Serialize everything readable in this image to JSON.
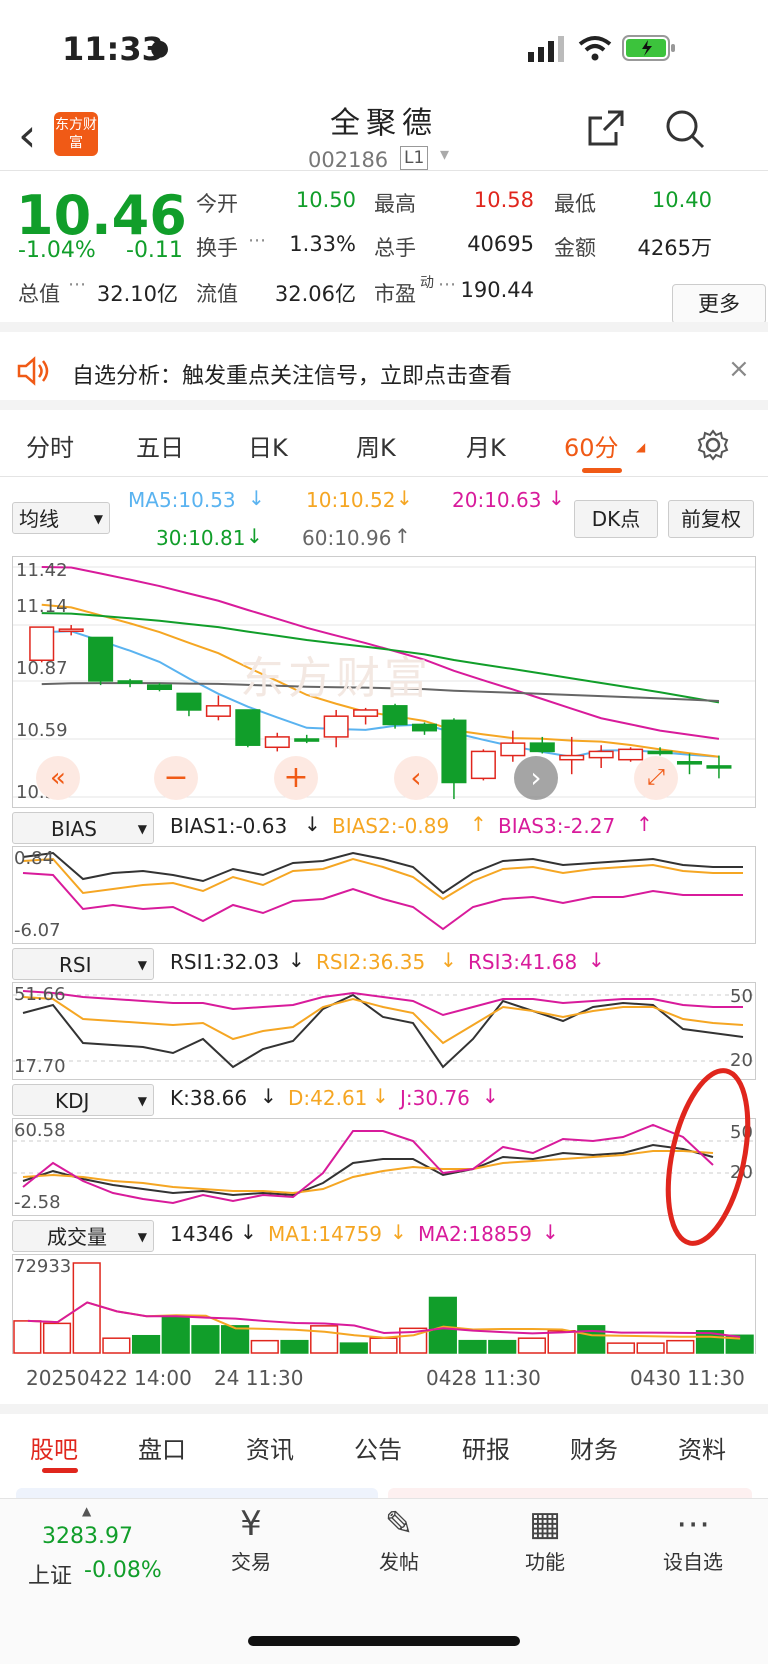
{
  "status": {
    "time": "11:33"
  },
  "nav": {
    "title": "全聚德",
    "code": "002186",
    "level_badge": "L1",
    "logo_text": "东方财富"
  },
  "quote": {
    "price": "10.46",
    "change_pct": "-1.04%",
    "change_abs": "-0.11",
    "open_label": "今开",
    "open": "10.50",
    "high_label": "最高",
    "high": "10.58",
    "low_label": "最低",
    "low": "10.40",
    "turnover_label": "换手",
    "turnover": "1.33%",
    "volume_label": "总手",
    "volume": "40695",
    "amount_label": "金额",
    "amount": "4265万",
    "mcap_label": "总值",
    "mcap": "32.10亿",
    "float_label": "流值",
    "float_cap": "32.06亿",
    "pe_label": "市盈",
    "pe_sup": "动",
    "pe": "190.44",
    "more_label": "更多"
  },
  "banner": {
    "text": "自选分析：触发重点关注信号，立即点击查看"
  },
  "period_tabs": [
    "分时",
    "五日",
    "日K",
    "周K",
    "月K",
    "60分"
  ],
  "ma_legend": {
    "select": "均线",
    "ma5": "MA5:10.53",
    "ma10": "10:10.52",
    "ma20": "20:10.63",
    "ma30": "30:10.81",
    "ma60": "60:10.96",
    "dk_label": "DK点",
    "adj_label": "前复权"
  },
  "main_axis": [
    "11.42",
    "11.14",
    "10.87",
    "10.59",
    "10.31"
  ],
  "bias": {
    "select": "BIAS",
    "b1": "BIAS1:-0.63",
    "b2": "BIAS2:-0.89",
    "b3": "BIAS3:-2.27",
    "top": "0.84",
    "bottom": "-6.07"
  },
  "rsi": {
    "select": "RSI",
    "r1": "RSI1:32.03",
    "r2": "RSI2:36.35",
    "r3": "RSI3:41.68",
    "top": "51.66",
    "bottom": "17.70",
    "right_top": "50",
    "right_bottom": "20"
  },
  "kdj": {
    "select": "KDJ",
    "k": "K:38.66",
    "d": "D:42.61",
    "j": "J:30.76",
    "top": "60.58",
    "bottom": "-2.58",
    "right_top": "50",
    "right_bottom": "20"
  },
  "vol": {
    "select": "成交量",
    "v": "14346",
    "ma1": "MA1:14759",
    "ma2": "MA2:18859",
    "top": "72933"
  },
  "time_axis": [
    "20250422 14:00",
    "24 11:30",
    "0428 11:30",
    "0430 11:30"
  ],
  "bottom_tabs": [
    "股吧",
    "盘口",
    "资讯",
    "公告",
    "研报",
    "财务",
    "资料"
  ],
  "dock": {
    "index_value": "3283.97",
    "index_name": "上证",
    "index_pct": "-0.08%",
    "trade": "交易",
    "post": "发帖",
    "functions": "功能",
    "add_fav": "设自选"
  },
  "candles": [
    {
      "o": 10.97,
      "h": 11.13,
      "l": 10.96,
      "c": 11.13,
      "up": true
    },
    {
      "o": 11.11,
      "h": 11.14,
      "l": 11.09,
      "c": 11.12,
      "up": true
    },
    {
      "o": 11.08,
      "h": 11.08,
      "l": 10.85,
      "c": 10.87,
      "up": false
    },
    {
      "o": 10.87,
      "h": 10.88,
      "l": 10.84,
      "c": 10.86,
      "up": false
    },
    {
      "o": 10.85,
      "h": 10.86,
      "l": 10.82,
      "c": 10.83,
      "up": false
    },
    {
      "o": 10.81,
      "h": 10.81,
      "l": 10.7,
      "c": 10.73,
      "up": false
    },
    {
      "o": 10.7,
      "h": 10.8,
      "l": 10.68,
      "c": 10.75,
      "up": true
    },
    {
      "o": 10.73,
      "h": 10.73,
      "l": 10.55,
      "c": 10.56,
      "up": false
    },
    {
      "o": 10.55,
      "h": 10.62,
      "l": 10.53,
      "c": 10.6,
      "up": true
    },
    {
      "o": 10.59,
      "h": 10.61,
      "l": 10.57,
      "c": 10.58,
      "up": false
    },
    {
      "o": 10.6,
      "h": 10.73,
      "l": 10.55,
      "c": 10.7,
      "up": true
    },
    {
      "o": 10.7,
      "h": 10.74,
      "l": 10.66,
      "c": 10.73,
      "up": true
    },
    {
      "o": 10.75,
      "h": 10.76,
      "l": 10.64,
      "c": 10.66,
      "up": false
    },
    {
      "o": 10.66,
      "h": 10.67,
      "l": 10.61,
      "c": 10.63,
      "up": false
    },
    {
      "o": 10.68,
      "h": 10.69,
      "l": 10.3,
      "c": 10.38,
      "up": false
    },
    {
      "o": 10.4,
      "h": 10.54,
      "l": 10.39,
      "c": 10.53,
      "up": true
    },
    {
      "o": 10.51,
      "h": 10.63,
      "l": 10.48,
      "c": 10.57,
      "up": true
    },
    {
      "o": 10.57,
      "h": 10.6,
      "l": 10.52,
      "c": 10.53,
      "up": false
    },
    {
      "o": 10.49,
      "h": 10.6,
      "l": 10.42,
      "c": 10.51,
      "up": true
    },
    {
      "o": 10.5,
      "h": 10.56,
      "l": 10.45,
      "c": 10.53,
      "up": true
    },
    {
      "o": 10.49,
      "h": 10.55,
      "l": 10.48,
      "c": 10.54,
      "up": true
    },
    {
      "o": 10.53,
      "h": 10.55,
      "l": 10.51,
      "c": 10.52,
      "up": false
    },
    {
      "o": 10.48,
      "h": 10.52,
      "l": 10.42,
      "c": 10.47,
      "up": false
    },
    {
      "o": 10.46,
      "h": 10.51,
      "l": 10.4,
      "c": 10.46,
      "up": false
    }
  ],
  "volumes": [
    26000,
    24000,
    72933,
    12000,
    14000,
    30000,
    22000,
    22000,
    10000,
    10000,
    22000,
    8000,
    12000,
    20000,
    45000,
    10000,
    10000,
    12000,
    18000,
    22000,
    8000,
    8000,
    10000,
    18000,
    14346
  ]
}
